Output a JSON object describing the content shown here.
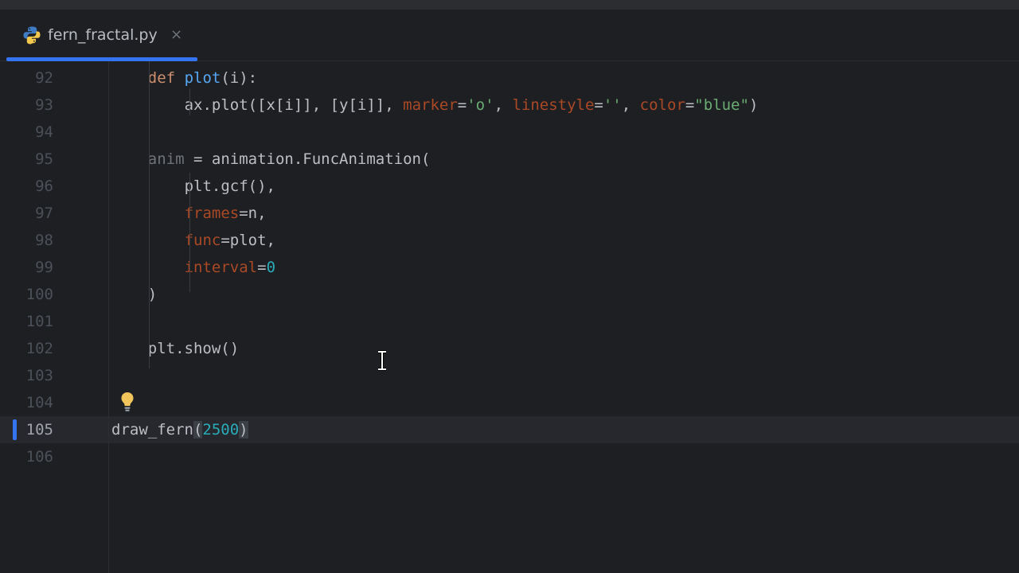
{
  "tab": {
    "filename": "fern_fractal.py",
    "close_glyph": "×"
  },
  "icons": {
    "file_type": "python-icon",
    "hint": "lightbulb-icon",
    "cursor": "text-cursor-icon"
  },
  "colors": {
    "accent": "#3574f0",
    "background": "#1e1f22",
    "keyword": "#cf8e6d",
    "function": "#56a8f5",
    "parameter": "#aa4926",
    "string": "#6aab73",
    "number": "#2aacb8"
  },
  "editor": {
    "current_line": "105",
    "lines": [
      {
        "num": "92",
        "tokens": [
          {
            "t": "def ",
            "c": "kw"
          },
          {
            "t": "plot",
            "c": "fn"
          },
          {
            "t": "(i):",
            "c": ""
          }
        ],
        "indent": 1
      },
      {
        "num": "93",
        "tokens": [
          {
            "t": "ax.plot([x[i]], [y[i]], ",
            "c": ""
          },
          {
            "t": "marker",
            "c": "param"
          },
          {
            "t": "=",
            "c": ""
          },
          {
            "t": "'o'",
            "c": "str"
          },
          {
            "t": ", ",
            "c": ""
          },
          {
            "t": "linestyle",
            "c": "param"
          },
          {
            "t": "=",
            "c": ""
          },
          {
            "t": "''",
            "c": "str"
          },
          {
            "t": ", ",
            "c": ""
          },
          {
            "t": "color",
            "c": "param"
          },
          {
            "t": "=",
            "c": ""
          },
          {
            "t": "\"blue\"",
            "c": "str"
          },
          {
            "t": ")",
            "c": ""
          }
        ],
        "indent": 2
      },
      {
        "num": "94",
        "tokens": [],
        "indent": 0
      },
      {
        "num": "95",
        "tokens": [
          {
            "t": "anim",
            "c": "unused"
          },
          {
            "t": " = animation.FuncAnimation(",
            "c": ""
          }
        ],
        "indent": 1
      },
      {
        "num": "96",
        "tokens": [
          {
            "t": "plt.gcf(),",
            "c": ""
          }
        ],
        "indent": 2
      },
      {
        "num": "97",
        "tokens": [
          {
            "t": "frames",
            "c": "param"
          },
          {
            "t": "=n,",
            "c": ""
          }
        ],
        "indent": 2
      },
      {
        "num": "98",
        "tokens": [
          {
            "t": "func",
            "c": "param"
          },
          {
            "t": "=plot,",
            "c": ""
          }
        ],
        "indent": 2
      },
      {
        "num": "99",
        "tokens": [
          {
            "t": "interval",
            "c": "param"
          },
          {
            "t": "=",
            "c": ""
          },
          {
            "t": "0",
            "c": "num"
          }
        ],
        "indent": 2
      },
      {
        "num": "100",
        "tokens": [
          {
            "t": ")",
            "c": ""
          }
        ],
        "indent": 1
      },
      {
        "num": "101",
        "tokens": [],
        "indent": 0
      },
      {
        "num": "102",
        "tokens": [
          {
            "t": "plt.show()",
            "c": ""
          }
        ],
        "indent": 1
      },
      {
        "num": "103",
        "tokens": [],
        "indent": 0
      },
      {
        "num": "104",
        "tokens": [],
        "indent": 0
      },
      {
        "num": "105",
        "tokens": [
          {
            "t": "draw_fern",
            "c": ""
          },
          {
            "t": "(",
            "c": "brace-hl"
          },
          {
            "t": "2500",
            "c": "num"
          },
          {
            "t": ")",
            "c": "brace-hl"
          }
        ],
        "indent": 0
      },
      {
        "num": "106",
        "tokens": [],
        "indent": 0
      }
    ]
  }
}
